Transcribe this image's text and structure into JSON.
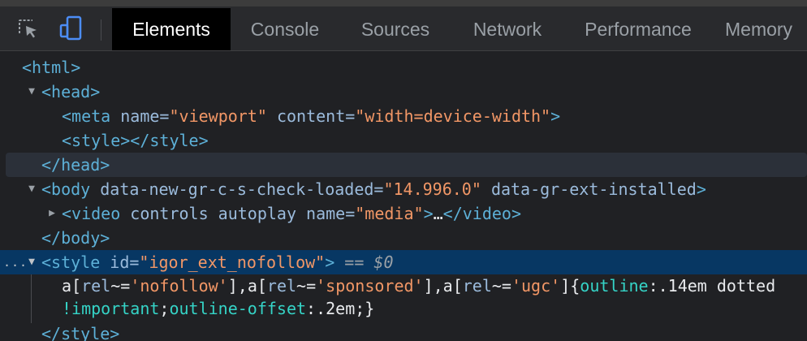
{
  "toolbar": {
    "tabs": [
      "Elements",
      "Console",
      "Sources",
      "Network",
      "Performance",
      "Memory"
    ],
    "active_tab": "Elements",
    "icons": [
      "inspect-element-icon",
      "device-toolbar-icon"
    ]
  },
  "colors": {
    "tag": "#5db0d7",
    "attribute_name": "#9bbbdc",
    "attribute_value": "#f29766",
    "selection": "#073763",
    "css_property": "#35d4c7"
  },
  "tree": {
    "html_open": "<html>",
    "head_open": "<head>",
    "meta": {
      "open": "<meta",
      "attr1_name": "name=",
      "attr1_value": "\"viewport\"",
      "attr2_name": "content=",
      "attr2_value": "\"width=device-width\"",
      "close": ">"
    },
    "style_empty": "<style></style>",
    "head_close": "</head>",
    "body": {
      "open": "<body",
      "attr1_name": "data-new-gr-c-s-check-loaded=",
      "attr1_value": "\"14.996.0\"",
      "attr2_name": "data-gr-ext-installed",
      "close": ">"
    },
    "video": {
      "open": "<video",
      "attr1_name": "controls",
      "attr2_name": "autoplay",
      "attr3_name": "name=",
      "attr3_value": "\"media\"",
      "close": ">",
      "ellipsis": "…",
      "end": "</video>"
    },
    "body_close": "</body>",
    "style_selected": {
      "dots": "...",
      "open": "<style",
      "attr_name": "id=",
      "attr_value": "\"igor_ext_nofollow\"",
      "close": ">",
      "marker": "== $0"
    },
    "css_line1": {
      "a1": "a[",
      "rel1": "rel",
      "op1": "~=",
      "v1": "'nofollow'",
      "sep1": "],a[",
      "rel2": "rel",
      "op2": "~=",
      "v2": "'sponsored'",
      "sep2": "],a[",
      "rel3": "rel",
      "op3": "~=",
      "v3": "'ugc'",
      "sep3": "]{",
      "prop": "outline",
      "rest": ":.14em dotted"
    },
    "css_line2": {
      "important": "!important",
      "semi": ";",
      "prop": "outline-offset",
      "rest": ":.2em;}"
    },
    "style_close": "</style>"
  }
}
